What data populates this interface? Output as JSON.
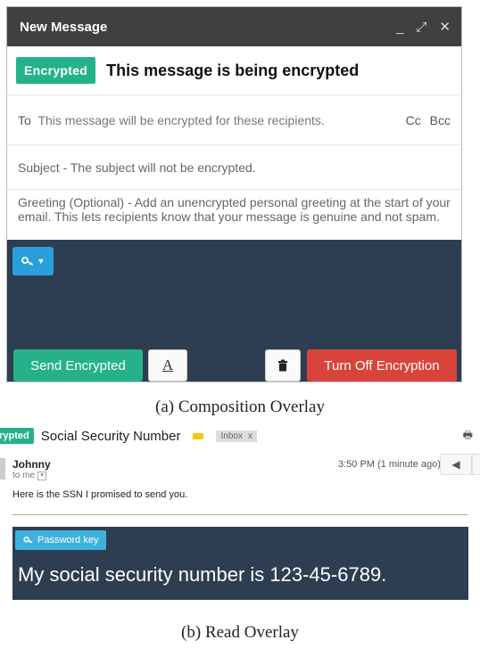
{
  "compose": {
    "title": "New Message",
    "window_controls": [
      "_",
      "⤢",
      "✕"
    ],
    "badge": "Encrypted",
    "heading": "This message is being encrypted",
    "to_label": "To",
    "to_placeholder": "This message will be encrypted for these recipients.",
    "cc": "Cc",
    "bcc": "Bcc",
    "subject_placeholder": "Subject - The subject will not be encrypted.",
    "greeting_placeholder": "Greeting (Optional) - Add an unencrypted personal greeting at the start of your email. This lets recipients know that your message is genuine and not spam.",
    "key_button_icon": "key-icon",
    "send_button": "Send Encrypted",
    "format_button": "A",
    "turn_off_button": "Turn Off Encryption"
  },
  "captions": {
    "a": "(a) Composition Overlay",
    "b": "(b) Read Overlay"
  },
  "read": {
    "badge": "crypted",
    "subject": "Social Security Number",
    "inbox_label": "Inbox",
    "inbox_close": "x",
    "sender": "Johnny",
    "to_me": "to me",
    "time": "3:50 PM (1 minute ago)",
    "body": "Here is the SSN I promised to send you.",
    "password_button": "Password key",
    "decrypted_text": "My social security number is 123-45-6789."
  },
  "colors": {
    "encrypted_green": "#25b28b",
    "dark_panel": "#2e3e52",
    "key_blue": "#2b9fd9",
    "danger_red": "#d9443a"
  }
}
